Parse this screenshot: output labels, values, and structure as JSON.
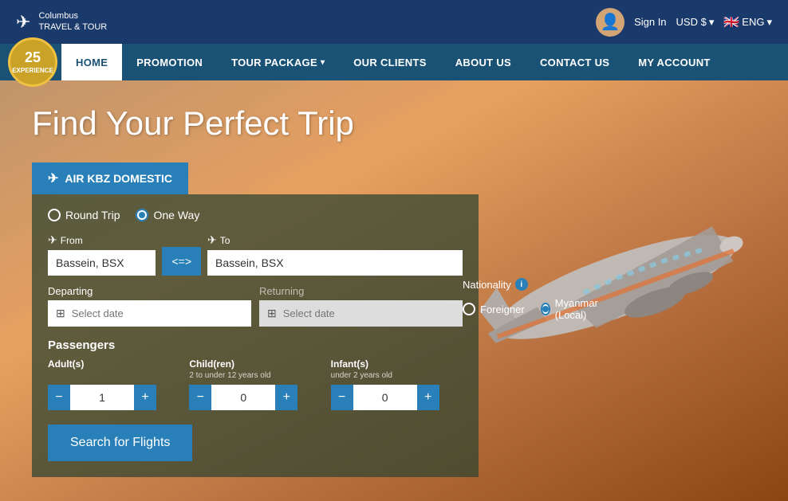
{
  "topbar": {
    "logo_name": "Columbus",
    "logo_sub": "TRAVEL & TOUR",
    "sign_in": "Sign In",
    "currency": "USD $",
    "lang": "ENG"
  },
  "nav": {
    "badge_years": "25",
    "badge_sub": "EXPERIENCE",
    "items": [
      {
        "label": "HOME",
        "active": true,
        "has_arrow": false
      },
      {
        "label": "PROMOTION",
        "active": false,
        "has_arrow": false
      },
      {
        "label": "TOUR PACKAGE",
        "active": false,
        "has_arrow": true
      },
      {
        "label": "OUR CLIENTS",
        "active": false,
        "has_arrow": false
      },
      {
        "label": "ABOUT US",
        "active": false,
        "has_arrow": false
      },
      {
        "label": "CONTACT US",
        "active": false,
        "has_arrow": false
      },
      {
        "label": "MY ACCOUNT",
        "active": false,
        "has_arrow": false
      }
    ]
  },
  "hero": {
    "title": "Find Your Perfect Trip"
  },
  "tab": {
    "label": "AIR KBZ DOMESTIC"
  },
  "search": {
    "trip_types": [
      {
        "label": "Round Trip",
        "checked": false
      },
      {
        "label": "One Way",
        "checked": true
      }
    ],
    "from_label": "From",
    "from_value": "Bassein, BSX",
    "swap_btn": "<=>",
    "to_label": "To",
    "to_value": "Bassein, BSX",
    "departing_label": "Departing",
    "departing_placeholder": "Select date",
    "returning_label": "Returning",
    "returning_placeholder": "Select date",
    "nationality_label": "Nationality",
    "nationality_options": [
      {
        "label": "Foreigner",
        "checked": false
      },
      {
        "label": "Myanmar (Local)",
        "checked": true
      }
    ],
    "passengers_title": "Passengers",
    "passengers": [
      {
        "label": "Adult(s)",
        "sublabel": "",
        "value": "1"
      },
      {
        "label": "Child(ren)",
        "sublabel": "2 to under 12 years old",
        "value": "0"
      },
      {
        "label": "Infant(s)",
        "sublabel": "under 2 years old",
        "value": "0"
      }
    ],
    "search_btn": "Search for Flights"
  }
}
